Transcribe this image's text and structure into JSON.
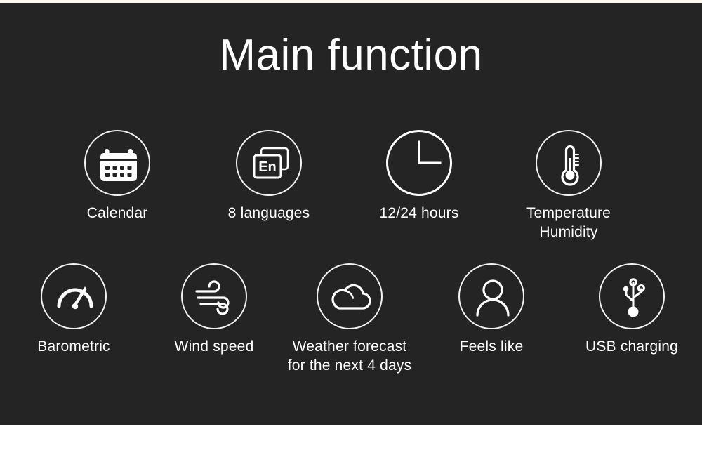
{
  "page": {
    "title": "Main function",
    "background_color": "#242424",
    "accent_color": "#ffffff",
    "top_strip_color": "#fdf8ef"
  },
  "rows": [
    {
      "row_index": 1,
      "features": [
        {
          "icon": "calendar-icon",
          "label_line1": "Calendar",
          "label_line2": ""
        },
        {
          "icon": "languages-icon",
          "label_line1": "8 languages",
          "label_line2": "",
          "icon_text": "En"
        },
        {
          "icon": "clock-icon",
          "label_line1": "12/24 hours",
          "label_line2": ""
        },
        {
          "icon": "thermometer-icon",
          "label_line1": "Temperature",
          "label_line2": "Humidity"
        }
      ]
    },
    {
      "row_index": 2,
      "features": [
        {
          "icon": "barometer-gauge-icon",
          "label_line1": "Barometric",
          "label_line2": ""
        },
        {
          "icon": "wind-icon",
          "label_line1": "Wind speed",
          "label_line2": ""
        },
        {
          "icon": "cloud-icon",
          "label_line1": "Weather forecast",
          "label_line2": "for the next 4 days"
        },
        {
          "icon": "person-icon",
          "label_line1": "Feels like",
          "label_line2": ""
        },
        {
          "icon": "usb-icon",
          "label_line1": "USB charging",
          "label_line2": ""
        }
      ]
    }
  ]
}
